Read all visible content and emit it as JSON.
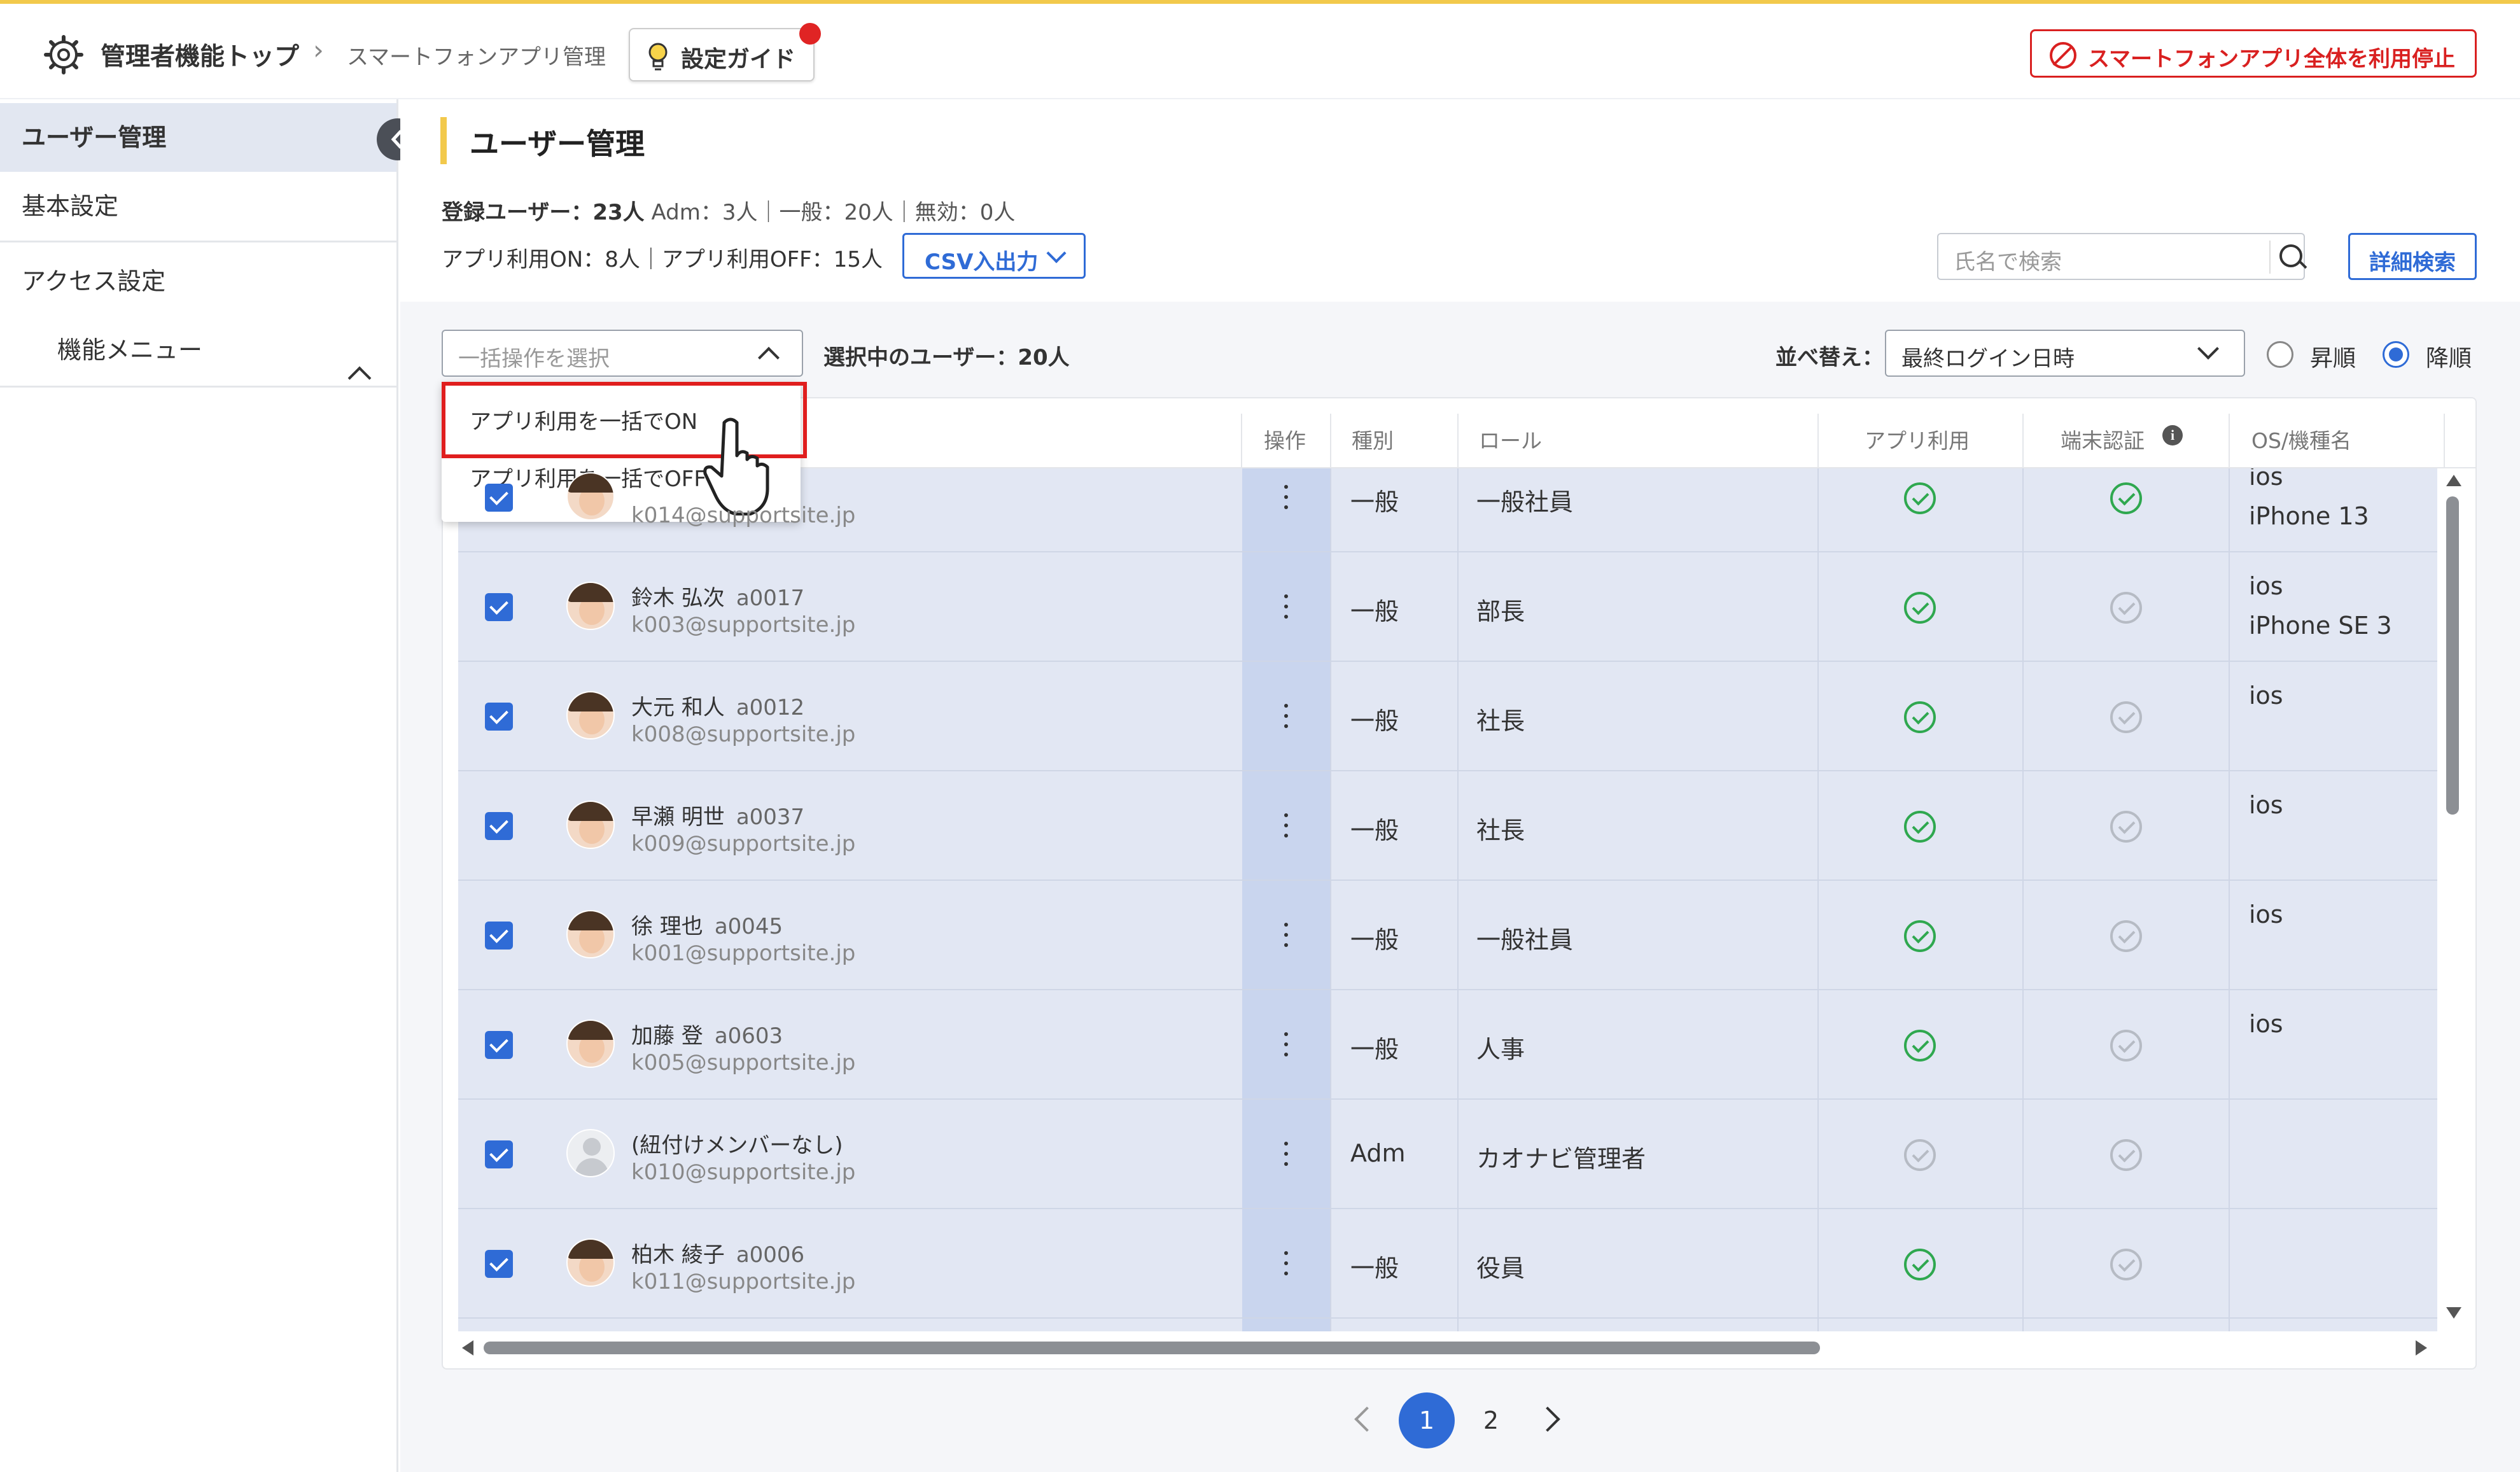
{
  "header": {
    "breadcrumb_home": "管理者機能トップ",
    "breadcrumb_sep": "›",
    "breadcrumb_current": "スマートフォンアプリ管理",
    "guide_label": "設定ガイド",
    "stop_label": "スマートフォンアプリ全体を利用停止"
  },
  "sidebar": {
    "items": [
      {
        "label": "ユーザー管理",
        "active": true
      },
      {
        "label": "基本設定"
      },
      {
        "label": "アクセス設定"
      },
      {
        "label": "機能メニュー"
      }
    ]
  },
  "main": {
    "title": "ユーザー管理",
    "stats_registered": "登録ユーザー：23人",
    "stats_breakdown": "Adm：3人｜一般：20人｜無効：0人",
    "stats_app": "アプリ利用ON：8人｜アプリ利用OFF：15人",
    "csv_label": "CSV入出力",
    "search_placeholder": "氏名で検索",
    "advanced_search_label": "詳細検索",
    "bulk_placeholder": "一括操作を選択",
    "selected_count": "選択中のユーザー：20人",
    "sort_label": "並べ替え：",
    "sort_value": "最終ログイン日時",
    "order_asc": "昇順",
    "order_desc": "降順",
    "order_selected": "降順"
  },
  "dropdown": {
    "items": [
      "アプリ利用を一括でON",
      "アプリ利用を一括でOFF"
    ]
  },
  "table": {
    "columns": [
      "操作",
      "種別",
      "ロール",
      "アプリ利用",
      "端末認証",
      "OS/機種名"
    ],
    "rows": [
      {
        "name": "",
        "code": "",
        "email": "k014@supportsite.jp",
        "type": "一般",
        "role": "一般社員",
        "app": true,
        "device": true,
        "os": "ios",
        "model": "iPhone 13",
        "checked": true
      },
      {
        "name": "鈴木 弘次",
        "code": "a0017",
        "email": "k003@supportsite.jp",
        "type": "一般",
        "role": "部長",
        "app": true,
        "device": false,
        "os": "ios",
        "model": "iPhone SE 3",
        "checked": true
      },
      {
        "name": "大元 和人",
        "code": "a0012",
        "email": "k008@supportsite.jp",
        "type": "一般",
        "role": "社長",
        "app": true,
        "device": false,
        "os": "ios",
        "model": "",
        "checked": true
      },
      {
        "name": "早瀬 明世",
        "code": "a0037",
        "email": "k009@supportsite.jp",
        "type": "一般",
        "role": "社長",
        "app": true,
        "device": false,
        "os": "ios",
        "model": "",
        "checked": true
      },
      {
        "name": "徐 理也",
        "code": "a0045",
        "email": "k001@supportsite.jp",
        "type": "一般",
        "role": "一般社員",
        "app": true,
        "device": false,
        "os": "ios",
        "model": "",
        "checked": true
      },
      {
        "name": "加藤 登",
        "code": "a0603",
        "email": "k005@supportsite.jp",
        "type": "一般",
        "role": "人事",
        "app": true,
        "device": false,
        "os": "ios",
        "model": "",
        "checked": true
      },
      {
        "name": "(紐付けメンバーなし)",
        "code": "",
        "email": "k010@supportsite.jp",
        "type": "Adm",
        "role": "カオナビ管理者",
        "app": false,
        "device": false,
        "os": "",
        "model": "",
        "checked": true
      },
      {
        "name": "柏木 綾子",
        "code": "a0006",
        "email": "k011@supportsite.jp",
        "type": "一般",
        "role": "役員",
        "app": true,
        "device": false,
        "os": "",
        "model": "",
        "checked": true
      }
    ]
  },
  "pagination": {
    "current": "1",
    "next_page": "2"
  },
  "colors": {
    "accent": "#2f6bd6",
    "danger": "#d92020",
    "check_on": "#2fa84f",
    "title_bar": "#f2c94c"
  }
}
